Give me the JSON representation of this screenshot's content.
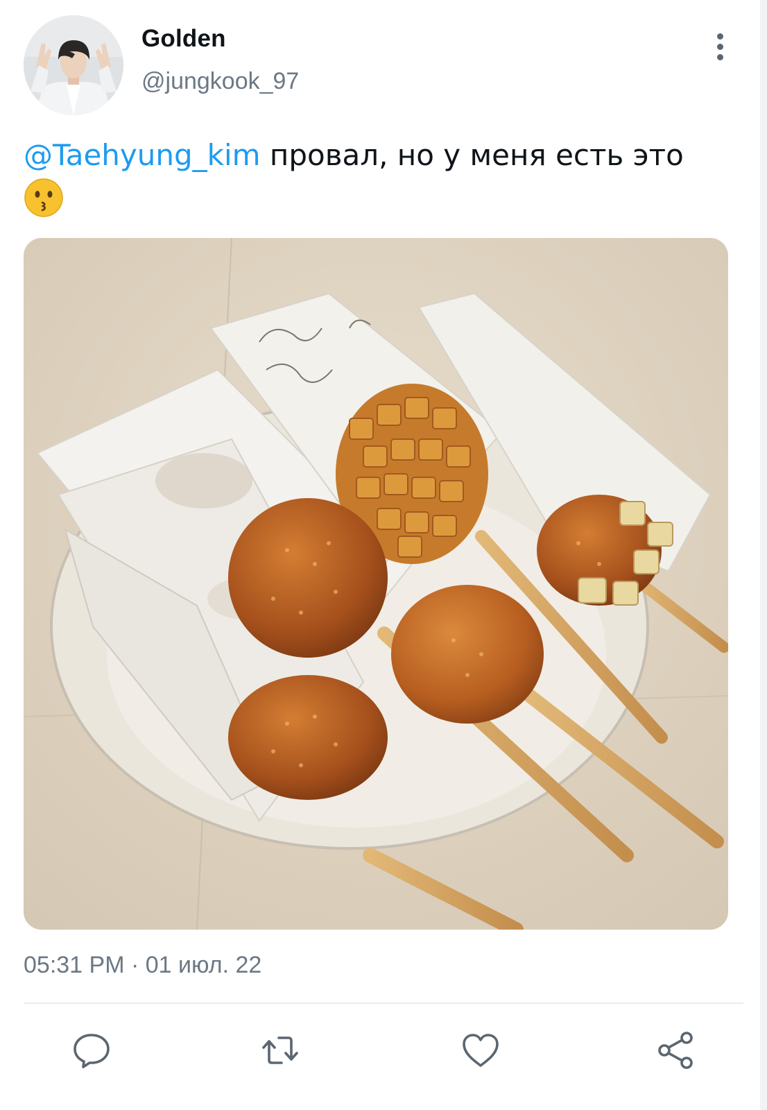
{
  "user": {
    "display_name": "Golden",
    "handle": "@jungkook_97"
  },
  "tweet": {
    "mention": "@Taehyung_kim",
    "text": " провал, но у меня есть это",
    "emoji": "😗",
    "timestamp": "05:31 PM · 01 июл. 22"
  },
  "actions": {
    "reply_icon": "speech-bubble-icon",
    "retweet_icon": "retweet-arrows-icon",
    "like_icon": "heart-icon",
    "share_icon": "share-nodes-icon"
  },
  "colors": {
    "mention": "#1d9bf0",
    "secondary_text": "#6b7884",
    "icon": "#5b6670"
  }
}
